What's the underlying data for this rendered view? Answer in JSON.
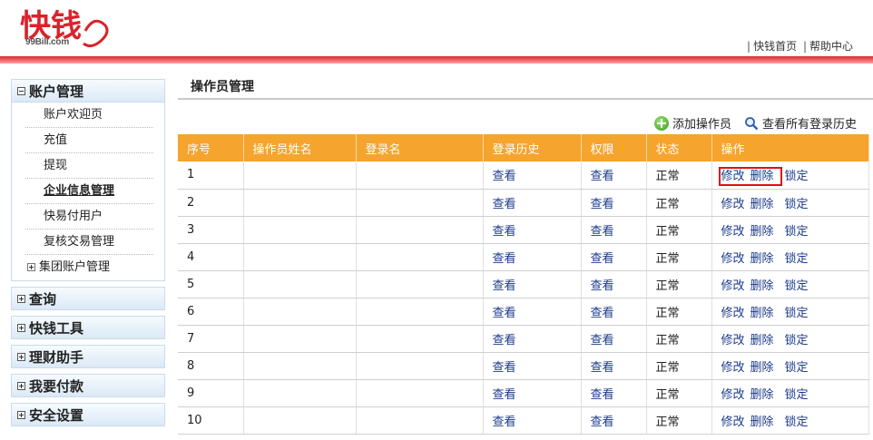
{
  "brand": {
    "logo_text": "快钱",
    "domain": "99Bill.com",
    "color": "#d9232b"
  },
  "top_links": {
    "home": "快钱首页",
    "help": "帮助中心"
  },
  "sidebar": {
    "account": {
      "title": "账户管理",
      "items": [
        "账户欢迎页",
        "充值",
        "提现",
        "企业信息管理",
        "快易付用户",
        "复核交易管理",
        "集团账户管理"
      ]
    },
    "collapsed": [
      "查询",
      "快钱工具",
      "理财助手",
      "我要付款",
      "安全设置"
    ]
  },
  "main": {
    "title": "操作员管理",
    "actions": {
      "add": "添加操作员",
      "history": "查看所有登录历史"
    },
    "table": {
      "headers": [
        "序号",
        "操作员姓名",
        "登录名",
        "登录历史",
        "权限",
        "状态",
        "操作"
      ],
      "view_label": "查看",
      "status_label": "正常",
      "op_edit": "修改",
      "op_delete": "删除",
      "op_lock": "锁定",
      "rows": [
        "1",
        "2",
        "3",
        "4",
        "5",
        "6",
        "7",
        "8",
        "9",
        "10"
      ]
    }
  }
}
